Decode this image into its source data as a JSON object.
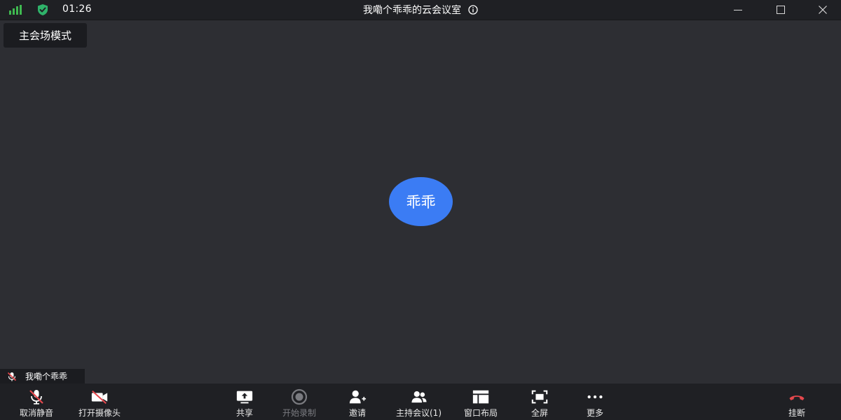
{
  "titlebar": {
    "timer": "01:26",
    "title": "我嘞个乖乖的云会议室",
    "icons": {
      "signal": "signal-strength-icon",
      "security": "shield-check-icon",
      "info": "info-icon",
      "minimize": "minimize-icon",
      "maximize": "maximize-icon",
      "close": "close-icon"
    }
  },
  "mode": {
    "label": "主会场模式"
  },
  "participant": {
    "avatar_text": "乖乖",
    "name": "我嘞个乖乖",
    "muted": true
  },
  "toolbar": {
    "items": [
      {
        "label": "取消静音",
        "icon": "mic-muted-icon"
      },
      {
        "label": "打开摄像头",
        "icon": "camera-off-icon"
      },
      {
        "label": "共享",
        "icon": "share-screen-icon"
      },
      {
        "label": "开始录制",
        "icon": "record-icon",
        "disabled": true
      },
      {
        "label": "邀请",
        "icon": "add-user-icon"
      },
      {
        "label": "主持会议(1)",
        "icon": "participants-icon"
      },
      {
        "label": "窗口布局",
        "icon": "layout-icon"
      },
      {
        "label": "全屏",
        "icon": "fullscreen-icon"
      },
      {
        "label": "更多",
        "icon": "more-icon"
      },
      {
        "label": "挂断",
        "icon": "hang-up-icon"
      }
    ]
  },
  "colors": {
    "background": "#2d2e33",
    "bar": "#1f2024",
    "avatar": "#3b7cf4",
    "signal": "#3fb950",
    "shield": "#2fb36a",
    "danger": "#e5484d",
    "text": "#ffffff"
  }
}
